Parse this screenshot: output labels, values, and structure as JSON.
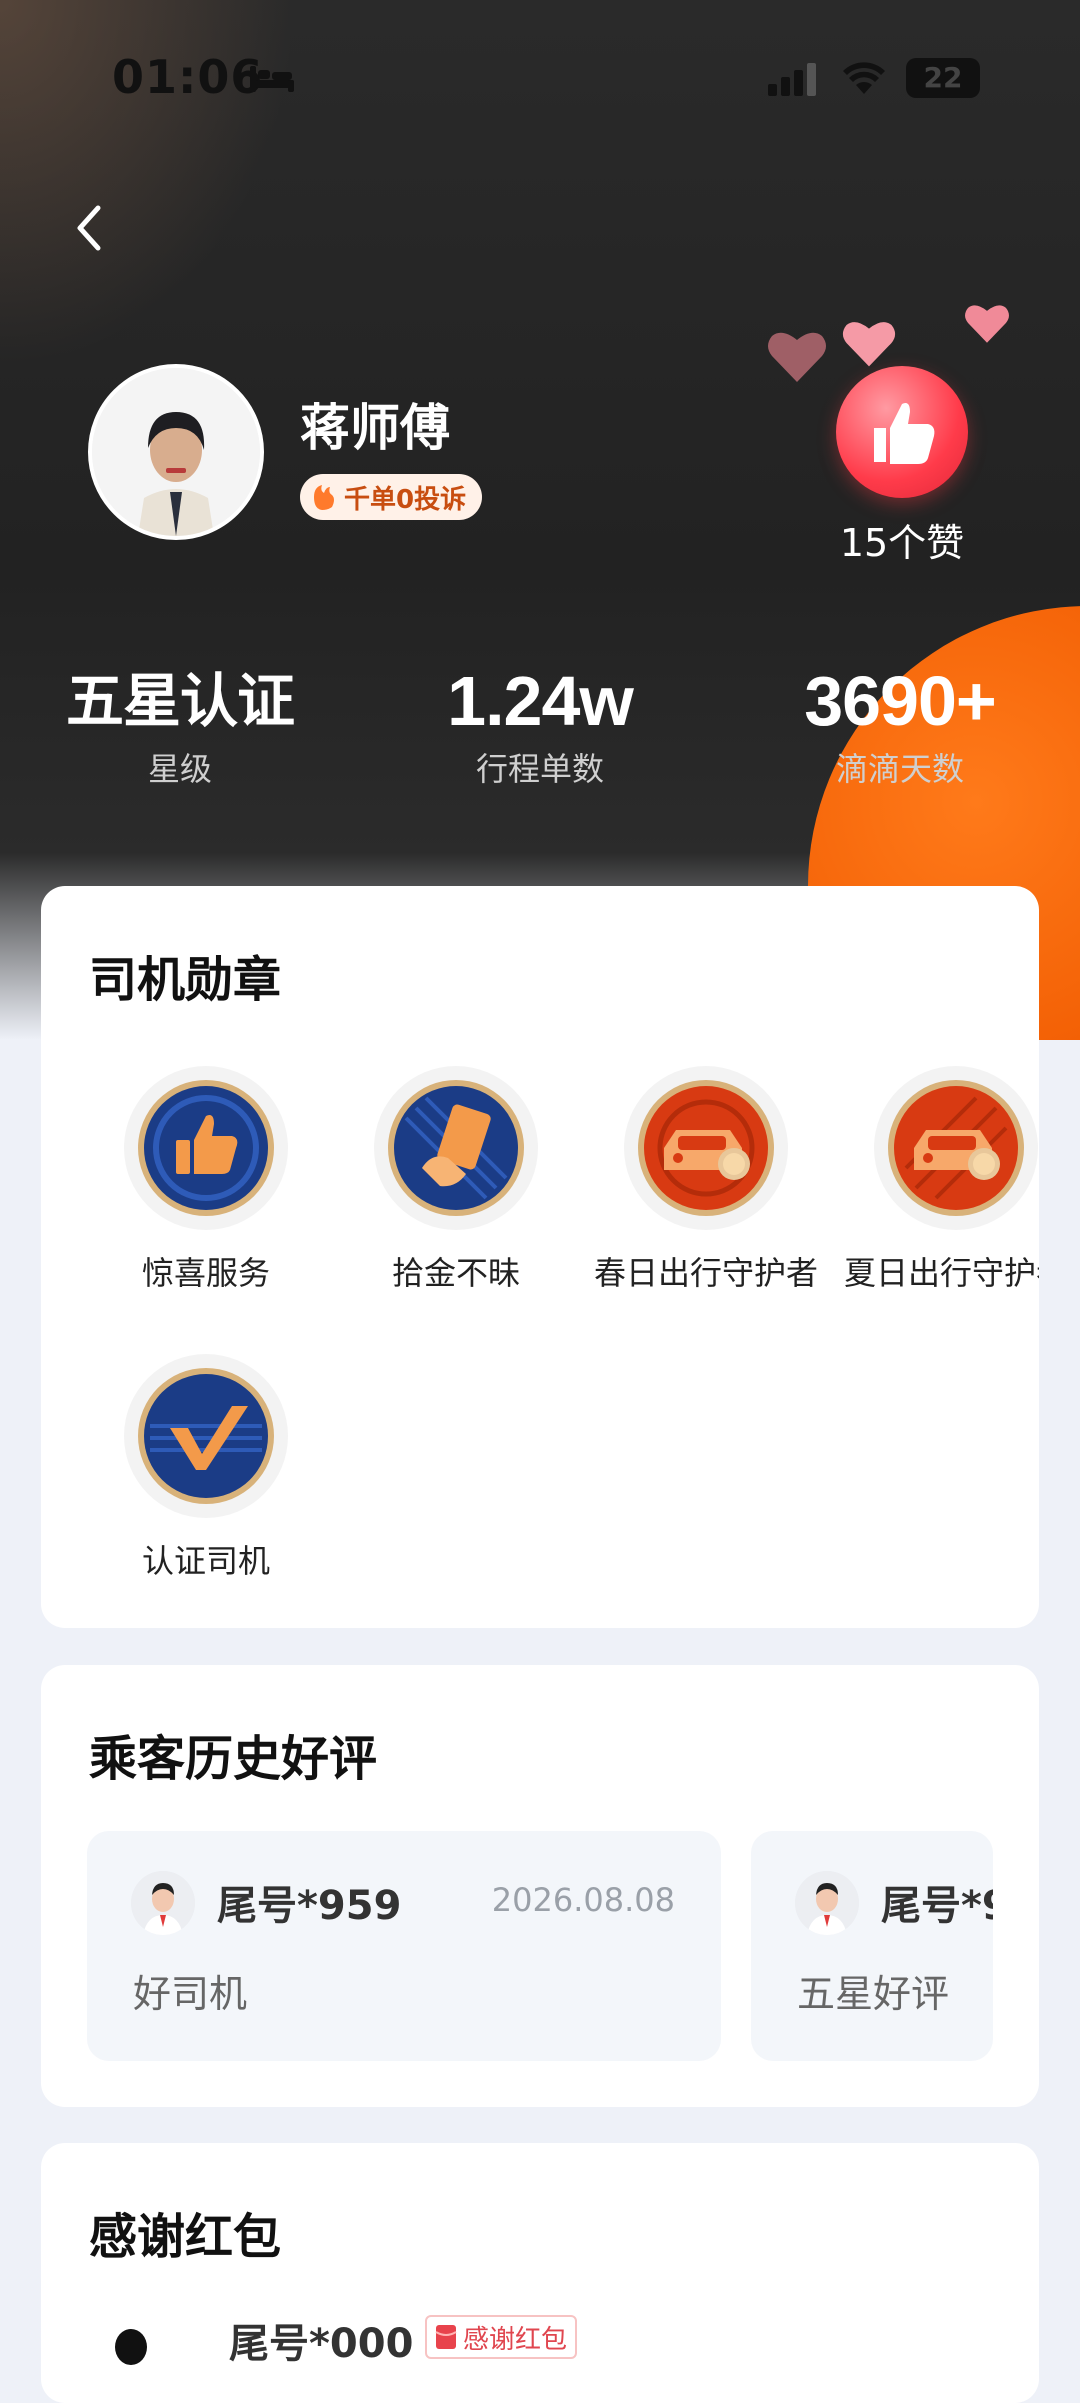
{
  "status_bar": {
    "time": "01:06",
    "battery": "22"
  },
  "profile": {
    "name": "蒋师傅",
    "pill_label": "千单0投诉",
    "likes_label": "15个赞"
  },
  "stats": [
    {
      "value": "五星认证",
      "label": "星级"
    },
    {
      "value": "1.24w",
      "label": "行程单数"
    },
    {
      "value": "3690+",
      "label": "滴滴天数"
    }
  ],
  "badges_card": {
    "title": "司机勋章",
    "items": [
      {
        "label": "惊喜服务",
        "icon": "thumbs-up-medal-icon"
      },
      {
        "label": "拾金不昧",
        "icon": "card-return-medal-icon"
      },
      {
        "label": "春日出行守护者",
        "icon": "spring-car-medal-icon"
      },
      {
        "label": "夏日出行守护者",
        "icon": "summer-car-medal-icon"
      },
      {
        "label": "认证司机",
        "icon": "check-medal-icon"
      }
    ]
  },
  "reviews_card": {
    "title": "乘客历史好评",
    "items": [
      {
        "tail": "尾号*959",
        "date": "2026.08.08",
        "text": "好司机"
      },
      {
        "tail": "尾号*9",
        "date": "",
        "text": "五星好评"
      }
    ]
  },
  "envelope_card": {
    "title": "感谢红包",
    "tail": "尾号*000",
    "tag": "感谢红包"
  },
  "colors": {
    "accent_orange": "#f05a00",
    "like_red": "#ff3b4a",
    "medal_navy": "#1b3c86",
    "medal_red": "#d83a12"
  }
}
